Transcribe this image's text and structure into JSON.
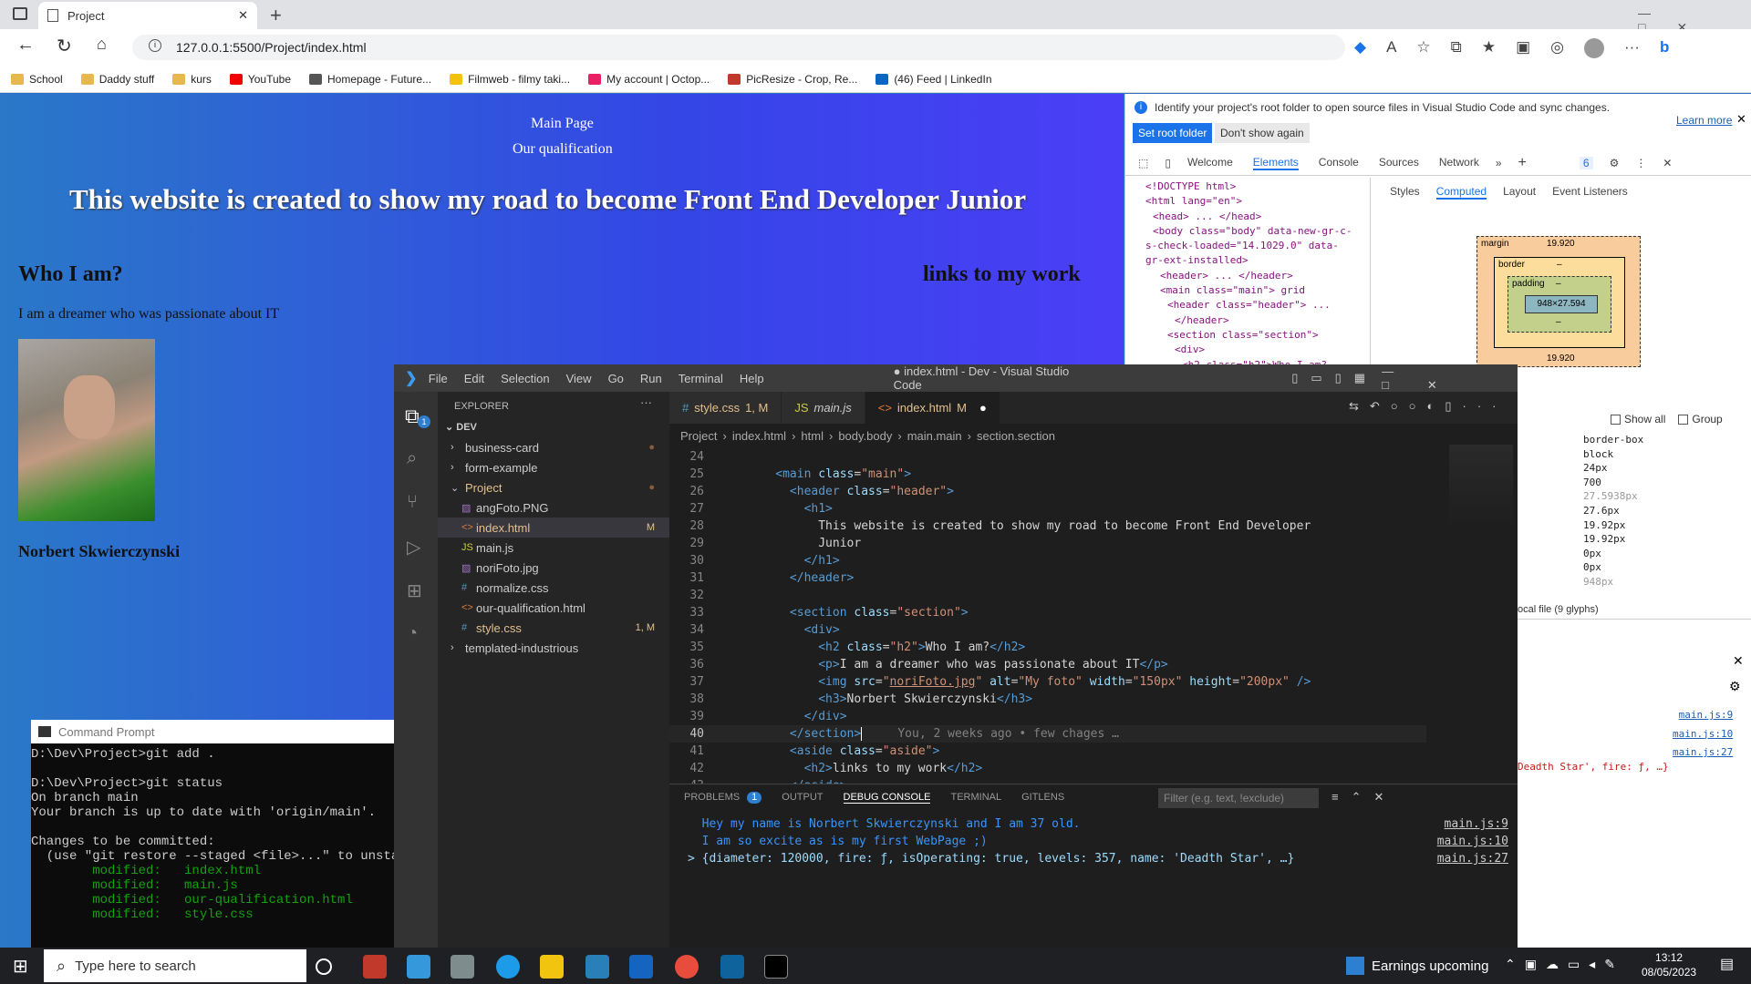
{
  "browser": {
    "tab_title": "Project",
    "url": "127.0.0.1:5500/Project/index.html",
    "bookmarks": [
      "School",
      "Daddy stuff",
      "kurs",
      "YouTube",
      "Homepage - Future...",
      "Filmweb - filmy taki...",
      "My account | Octop...",
      "PicResize - Crop, Re...",
      "(46) Feed | LinkedIn"
    ]
  },
  "page": {
    "nav": [
      "Main Page",
      "Our qualification"
    ],
    "h1": "This website is created to show my road to become Front End Developer Junior",
    "h2": "Who I am?",
    "p": "I am a dreamer who was passionate about IT",
    "h3": "Norbert Skwierczynski",
    "aside_h2": "links to my work"
  },
  "devtools": {
    "banner": "Identify your project's root folder to open source files in Visual Studio Code and sync changes.",
    "learn_more": "Learn more",
    "set_root": "Set root folder",
    "dont_show": "Don't show again",
    "tabs": [
      "Welcome",
      "Elements",
      "Console",
      "Sources",
      "Network"
    ],
    "issues": "6",
    "dom": [
      "<!DOCTYPE html>",
      "<html lang=\"en\">",
      "<head> ... </head>",
      "<body class=\"body\" data-new-gr-c-",
      "s-check-loaded=\"14.1029.0\" data-",
      "gr-ext-installed>",
      "<header> ... </header>",
      "<main class=\"main\"> grid",
      "<header class=\"header\"> ...",
      "</header>",
      "<section class=\"section\">",
      "<div>",
      "<h2 class=\"h2\">Who I am?"
    ],
    "subtabs": [
      "Styles",
      "Computed",
      "Layout",
      "Event Listeners"
    ],
    "box": {
      "margin_label": "margin",
      "margin_top": "19.920",
      "border_label": "border",
      "border_val": "–",
      "padding_label": "padding",
      "padding_val": "–",
      "content": "948×27.594",
      "dash": "–",
      "margin_bottom": "19.920"
    },
    "show_all": "Show all",
    "group": "Group",
    "computed": [
      "border-box",
      "block",
      "24px",
      "700",
      "27.5938px",
      "27.6px",
      "19.92px",
      "19.92px",
      "0px",
      "0px",
      "948px"
    ],
    "font_info": "ocal file (9 glyphs)",
    "console_links": [
      "main.js:9",
      "main.js:10",
      "main.js:27"
    ],
    "console_frag": "Deadth Star', fire: ƒ, …}"
  },
  "cmd": {
    "title": "Command Prompt",
    "lines": [
      "D:\\Dev\\Project>git add .",
      "",
      "D:\\Dev\\Project>git status",
      "On branch main",
      "Your branch is up to date with 'origin/main'.",
      "",
      "Changes to be committed:",
      "  (use \"git restore --staged <file>...\" to unstage"
    ],
    "modified": [
      [
        "modified:",
        "index.html"
      ],
      [
        "modified:",
        "main.js"
      ],
      [
        "modified:",
        "our-qualification.html"
      ],
      [
        "modified:",
        "style.css"
      ]
    ]
  },
  "vscode": {
    "menu": [
      "File",
      "Edit",
      "Selection",
      "View",
      "Go",
      "Run",
      "Terminal",
      "Help"
    ],
    "title": "● index.html - Dev - Visual Studio Code",
    "explorer": "EXPLORER",
    "root": "DEV",
    "tree": [
      {
        "name": "business-card",
        "type": "folder",
        "indent": 0,
        "badge": "●"
      },
      {
        "name": "form-example",
        "type": "folder",
        "indent": 0,
        "badge": ""
      },
      {
        "name": "Project",
        "type": "folder-open",
        "indent": 0,
        "badge": "●"
      },
      {
        "name": "angFoto.PNG",
        "type": "img",
        "indent": 1,
        "badge": ""
      },
      {
        "name": "index.html",
        "type": "html",
        "indent": 1,
        "badge": "M"
      },
      {
        "name": "main.js",
        "type": "js",
        "indent": 1,
        "badge": ""
      },
      {
        "name": "noriFoto.jpg",
        "type": "img",
        "indent": 1,
        "badge": ""
      },
      {
        "name": "normalize.css",
        "type": "css",
        "indent": 1,
        "badge": ""
      },
      {
        "name": "our-qualification.html",
        "type": "html",
        "indent": 1,
        "badge": ""
      },
      {
        "name": "style.css",
        "type": "css",
        "indent": 1,
        "badge": "1, M"
      },
      {
        "name": "templated-industrious",
        "type": "folder",
        "indent": 0,
        "badge": ""
      }
    ],
    "tabs": [
      {
        "label": "style.css",
        "suffix": "1, M",
        "icon": "#"
      },
      {
        "label": "main.js",
        "suffix": "",
        "icon": "JS"
      },
      {
        "label": "index.html",
        "suffix": "M",
        "icon": "<>"
      }
    ],
    "breadcrumb": [
      "Project",
      "index.html",
      "html",
      "body.body",
      "main.main",
      "section.section"
    ],
    "blame": "You, 2 weeks ago • few chages …",
    "panel_tabs": [
      "PROBLEMS",
      "OUTPUT",
      "DEBUG CONSOLE",
      "TERMINAL",
      "GITLENS"
    ],
    "problems_count": "1",
    "filter": "Filter (e.g. text, !exclude)",
    "console": [
      {
        "text": "Hey my name is Norbert Skwierczynski and I am 37 old.",
        "link": "main.js:9"
      },
      {
        "text": "I am so excite as is my first WebPage ;)",
        "link": "main.js:10"
      },
      {
        "text": "{diameter: 120000, fire: ƒ, isOperating: true, levels: 357, name: 'Deadth Star', …}",
        "link": "main.js:27"
      }
    ]
  },
  "taskbar": {
    "search": "Type here to search",
    "earnings": "Earnings upcoming",
    "time": "13:12",
    "date": "08/05/2023"
  }
}
